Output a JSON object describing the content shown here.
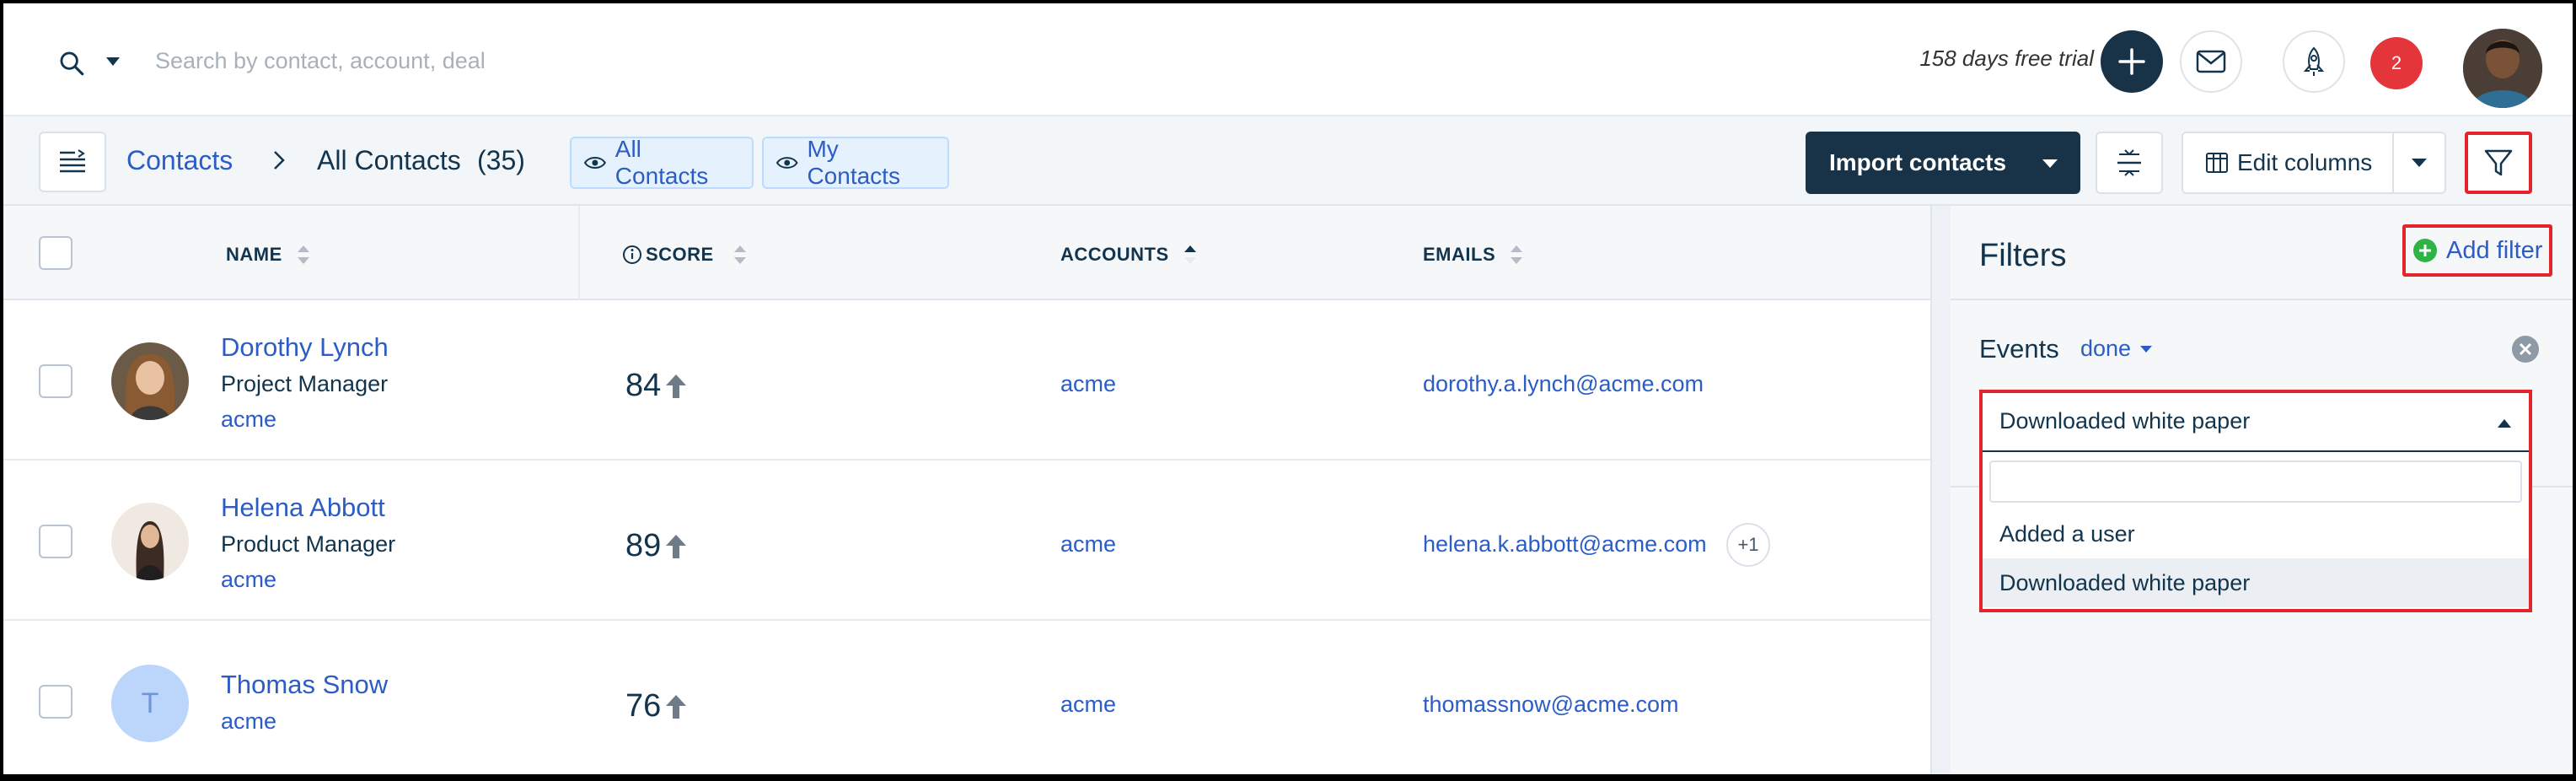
{
  "topbar": {
    "search_placeholder": "Search by contact, account, deal",
    "trial_text": "158 days free trial",
    "notification_count": "2"
  },
  "toolbar": {
    "breadcrumb_root": "Contacts",
    "breadcrumb_current": "All Contacts",
    "breadcrumb_count": "(35)",
    "views": [
      {
        "label": "All Contacts"
      },
      {
        "label": "My Contacts"
      }
    ],
    "import_label": "Import contacts",
    "edit_columns_label": "Edit columns"
  },
  "table": {
    "columns": {
      "name": "NAME",
      "score": "SCORE",
      "accounts": "ACCOUNTS",
      "emails": "EMAILS"
    },
    "rows": [
      {
        "name": "Dorothy Lynch",
        "title": "Project Manager",
        "account": "acme",
        "score": "84",
        "accounts": "acme",
        "email": "dorothy.a.lynch@acme.com",
        "extra": ""
      },
      {
        "name": "Helena Abbott",
        "title": "Product Manager",
        "account": "acme",
        "score": "89",
        "accounts": "acme",
        "email": "helena.k.abbott@acme.com",
        "extra": "+1"
      },
      {
        "name": "Thomas Snow",
        "title": "",
        "account": "acme",
        "score": "76",
        "accounts": "acme",
        "email": "thomassnow@acme.com",
        "extra": "",
        "initial": "T"
      }
    ]
  },
  "filters": {
    "title": "Filters",
    "add_filter_label": "Add filter",
    "events_label": "Events",
    "done_label": "done",
    "dropdown": {
      "selected": "Downloaded white paper",
      "search_value": "",
      "options": [
        "Added a user",
        "Downloaded white paper"
      ]
    }
  },
  "colors": {
    "accent": "#2c5cc5",
    "navy": "#183247",
    "highlight_red": "#e3242b",
    "badge_red": "#e3353a",
    "add_green": "#2fb344"
  }
}
